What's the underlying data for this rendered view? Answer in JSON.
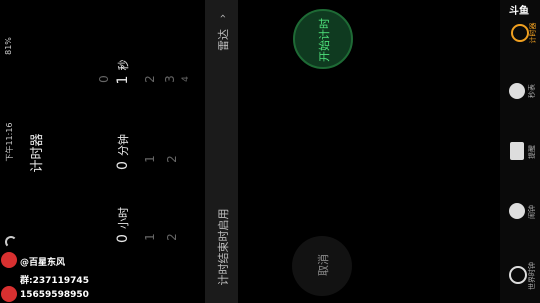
{
  "status_bar": {
    "time": "下午11:16",
    "battery": "81%"
  },
  "app_title": "计时器",
  "picker": {
    "hours": {
      "current": "0",
      "unit": "小时",
      "below": [
        "1",
        "2"
      ]
    },
    "minutes": {
      "current": "0",
      "unit": "分钟",
      "below": [
        "1",
        "2"
      ]
    },
    "seconds": {
      "above": "0",
      "current": "1",
      "unit": "秒",
      "below": [
        "2",
        "3",
        "4"
      ]
    }
  },
  "panel": {
    "label": "计时结束时启用",
    "value": "雷达"
  },
  "buttons": {
    "start": "开始计时",
    "cancel": "取消"
  },
  "nav": {
    "brand": "斗鱼",
    "items": [
      {
        "label": "计时器",
        "icon": "timer-icon"
      },
      {
        "label": "秒表",
        "icon": "stopwatch-icon"
      },
      {
        "label": "提醒",
        "icon": "alarm-icon"
      },
      {
        "label": "闹钟",
        "icon": "alarm-clock-icon"
      },
      {
        "label": "世界时钟",
        "icon": "globe-icon"
      }
    ]
  },
  "watermark": {
    "name": "@百星东风",
    "group": "群:237119745",
    "phone": "15659598950"
  },
  "colors": {
    "accent": "#4ee07a",
    "start_bg": "#0f3a20",
    "panel_bg": "#1b1b1b"
  }
}
